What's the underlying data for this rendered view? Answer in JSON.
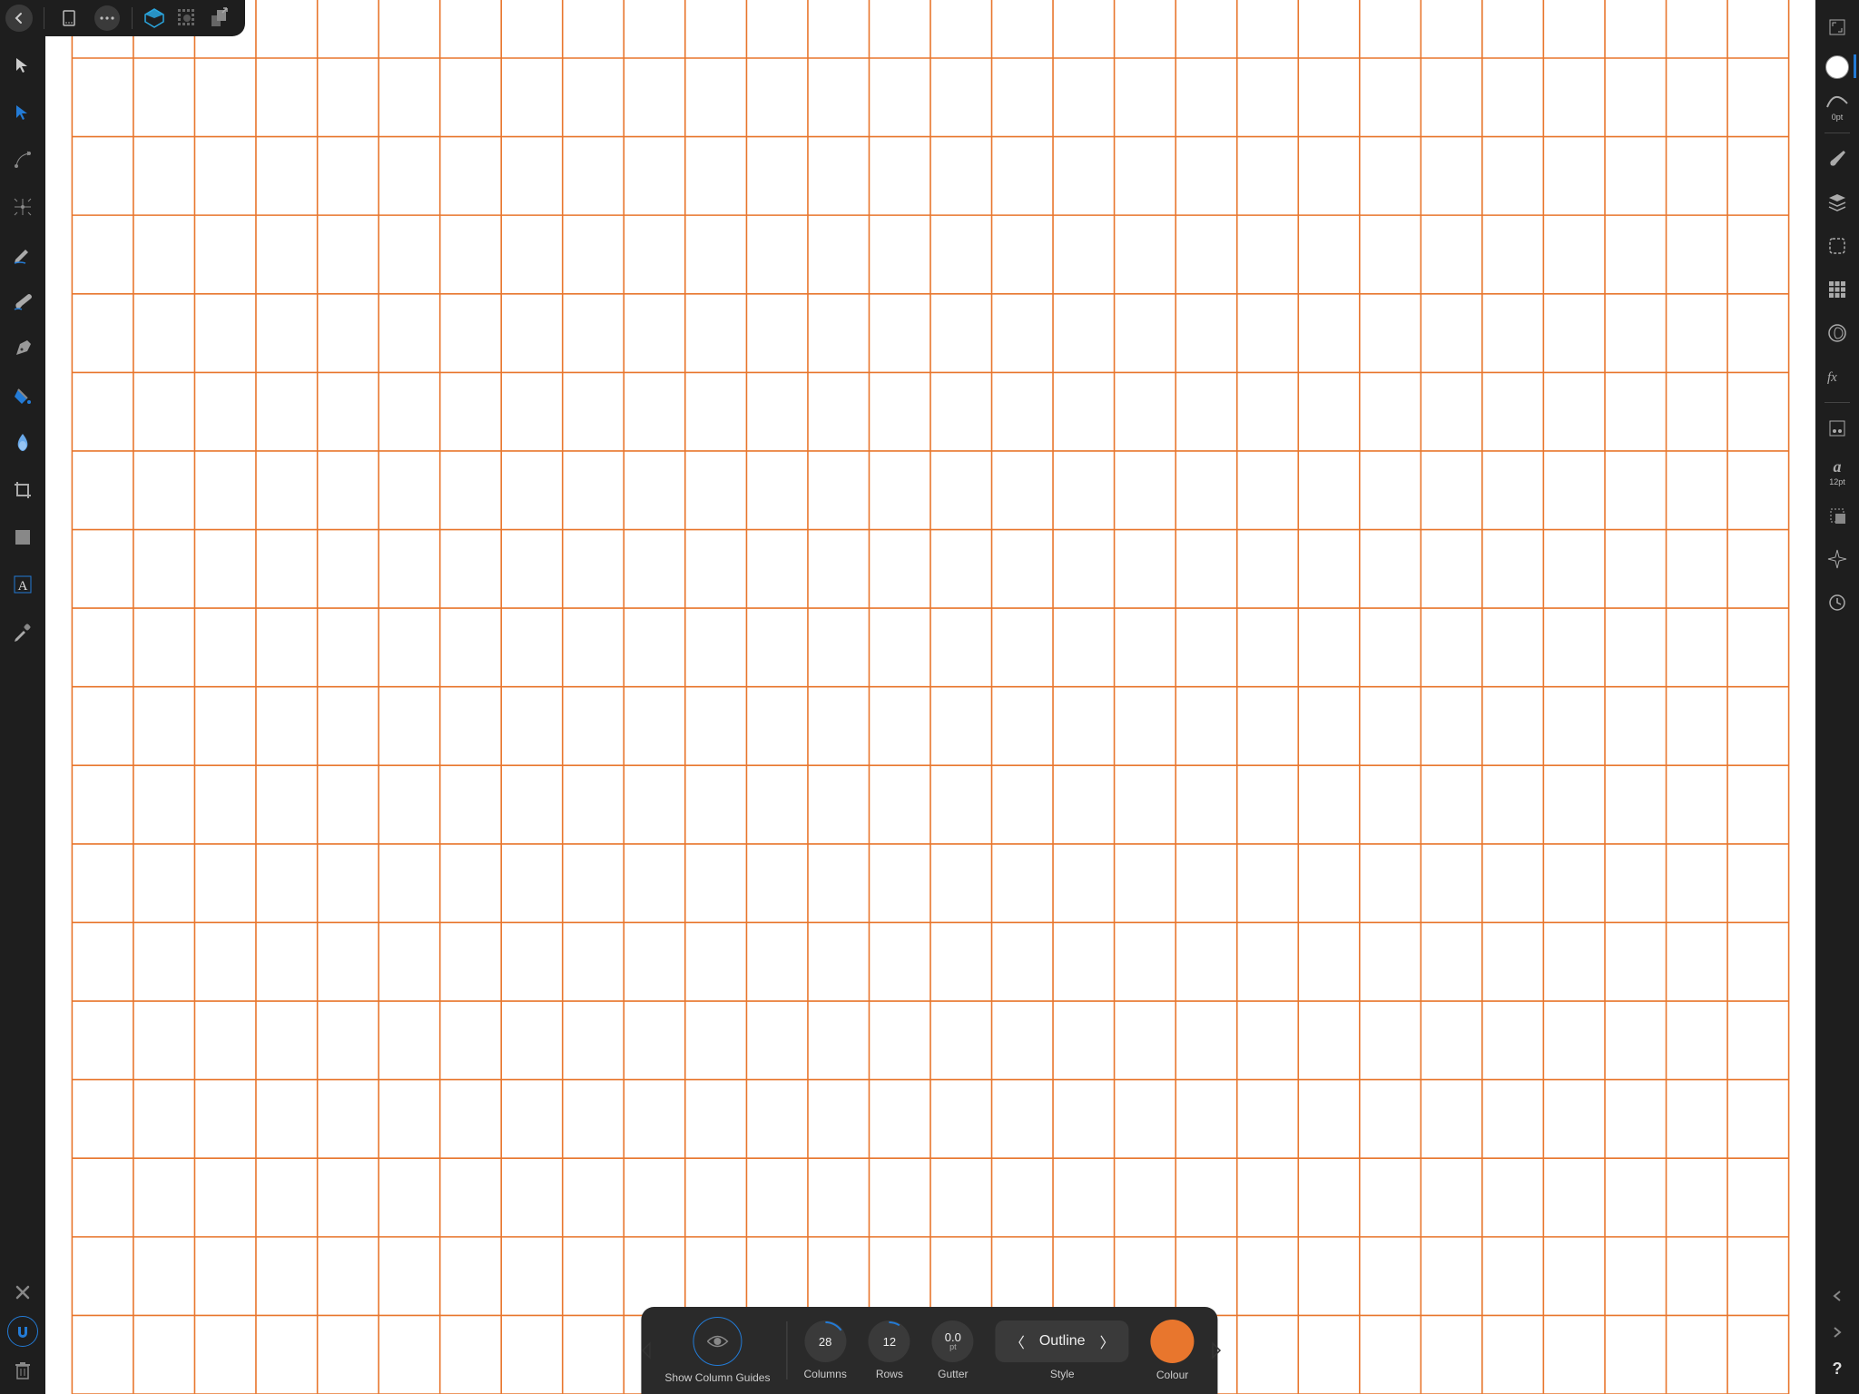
{
  "grid": {
    "columns": 28,
    "rows": 17,
    "color": "#e8762d"
  },
  "topbar": {
    "back": "back",
    "document": "document",
    "more": "more",
    "personas": [
      "Designer",
      "Pixel",
      "Export"
    ]
  },
  "left_tools": [
    {
      "name": "move-tool"
    },
    {
      "name": "node-tool"
    },
    {
      "name": "point-transform-tool"
    },
    {
      "name": "corner-tool"
    },
    {
      "name": "pencil-tool"
    },
    {
      "name": "vector-brush-tool"
    },
    {
      "name": "pen-tool"
    },
    {
      "name": "fill-tool"
    },
    {
      "name": "transparency-tool"
    },
    {
      "name": "crop-tool"
    },
    {
      "name": "shape-tool"
    },
    {
      "name": "text-tool"
    },
    {
      "name": "colour-picker-tool"
    }
  ],
  "right_studios": {
    "stroke_width": "0pt",
    "text_size": "12pt"
  },
  "context": {
    "show_guides_label": "Show Column Guides",
    "columns": {
      "label": "Columns",
      "value": "28"
    },
    "rows": {
      "label": "Rows",
      "value": "12"
    },
    "gutter": {
      "label": "Gutter",
      "value": "0.0",
      "unit": "pt"
    },
    "style": {
      "label": "Style",
      "value": "Outline"
    },
    "colour": {
      "label": "Colour",
      "value": "#e8762d"
    }
  }
}
